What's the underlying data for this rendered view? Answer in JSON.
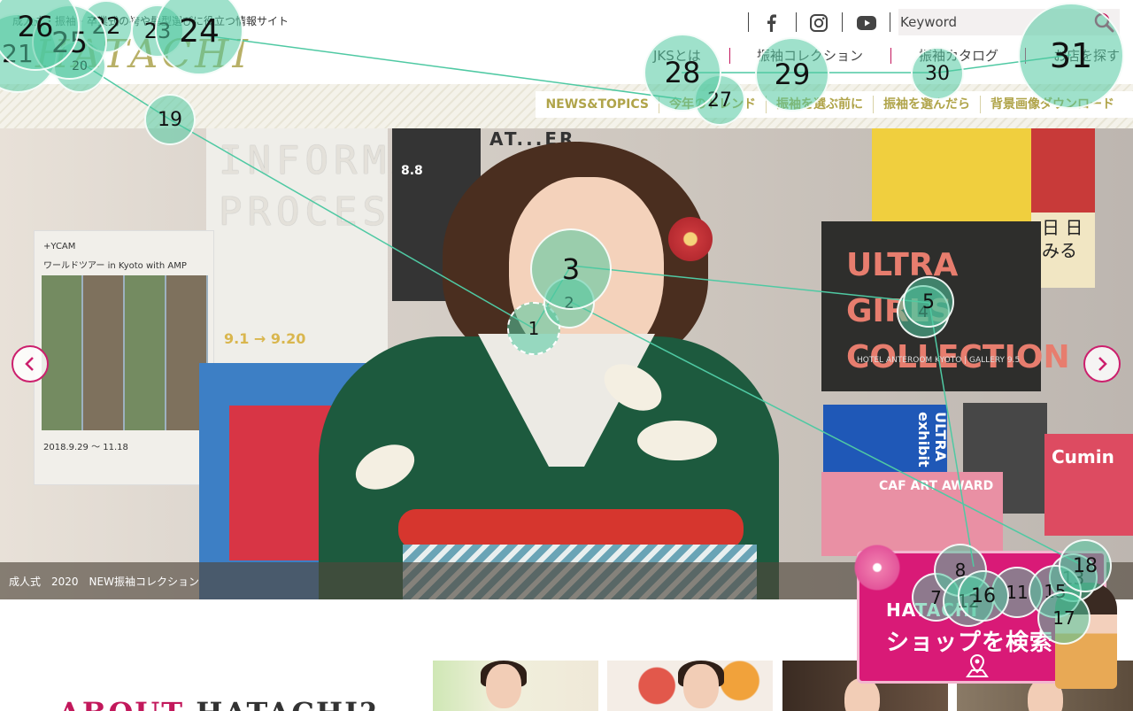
{
  "header": {
    "tagline": "成人式・振袖・卒業式の袴や髪型選びに役立つ情報サイト",
    "logo": "HATACHI",
    "search_placeholder": "Keyword",
    "social": [
      "facebook-icon",
      "instagram-icon",
      "youtube-icon"
    ],
    "main_nav": [
      "JKSとは",
      "振袖コレクション",
      "振袖カタログ",
      "お店を探す"
    ],
    "sub_nav": [
      "NEWS&TOPICS",
      "今年のトレンド",
      "振袖を選ぶ前に",
      "振袖を選んだら",
      "背景画像ダウンロード"
    ]
  },
  "hero": {
    "caption": "成人式　2020　NEW振袖コレクション",
    "posters": {
      "left_title": "ワールドツアー in Kyoto with AMP",
      "left_heading": "+YCAM",
      "left_date": "2018.9.29 ～ 11.18",
      "informal": "INFORMAL PROCESS",
      "informal_dates": "9.1 → 9.20",
      "dark": "8.8",
      "at": "AT...ER.",
      "ultra": "ULTRA GIRLS COLLECTION",
      "ultra_sub": "HOTEL ANTEROOM KYOTO | GALLERY 9.5",
      "ultrablue": "ULTRA exhibit",
      "caf": "CAF ART AWARD",
      "cumin": "Cumin",
      "red2": "日 日 みる"
    }
  },
  "shop_widget": {
    "brand": "HATACHI",
    "label": "ショップを検索"
  },
  "about": {
    "part1": "ABOUT",
    "part2": "HATACHI?"
  },
  "markers": [
    "1",
    "2",
    "3",
    "4",
    "5",
    "7",
    "8",
    "11",
    "12",
    "13",
    "15",
    "16",
    "17",
    "18",
    "19",
    "20",
    "21",
    "22",
    "23",
    "24",
    "25",
    "26",
    "27",
    "28",
    "29",
    "30",
    "31"
  ],
  "colors": {
    "accent": "#cc1f6d",
    "gold": "#b0a44a",
    "marker": "#50c8a0"
  }
}
